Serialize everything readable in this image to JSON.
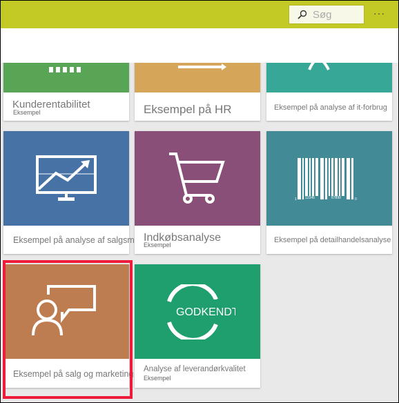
{
  "header": {
    "search_placeholder": "Søg",
    "more_label": "···",
    "bg_color": "#c4ca25"
  },
  "cards": [
    {
      "title": "Kunderentabilitet",
      "subtitle": "Eksempel",
      "color": "#58a555",
      "icon": "bar-chart-icon"
    },
    {
      "title": "Eksempel på HR",
      "color": "#d5a55a",
      "icon": "arrow-icon"
    },
    {
      "title": "Eksempel på analyse af it-forbrug",
      "color": "#37a797",
      "icon": "gauge-icon"
    },
    {
      "title": "Eksempel på analyse af salgsmuligheder",
      "color": "#4672a6",
      "icon": "trend-monitor-icon"
    },
    {
      "title": "Indkøbsanalyse",
      "subtitle": "Eksempel",
      "color": "#894f78",
      "icon": "shopping-cart-icon"
    },
    {
      "title": "Eksempel på detailhandelsanalyse",
      "color": "#428a96",
      "icon": "barcode-icon",
      "barcode": {
        "a": "1",
        "b": "12345",
        "c": "67890",
        "d": "0"
      }
    },
    {
      "title": "Eksempel på salg og marketing",
      "color": "#bd7d50",
      "icon": "person-speech-icon",
      "selected": true
    },
    {
      "title": "Analyse af leverandørkvalitet",
      "subtitle": "Eksempel",
      "color": "#1f9e6e",
      "icon": "approved-stamp-icon",
      "stamp_text": "GODKENDT"
    }
  ],
  "highlight_color": "#ee1c3a"
}
